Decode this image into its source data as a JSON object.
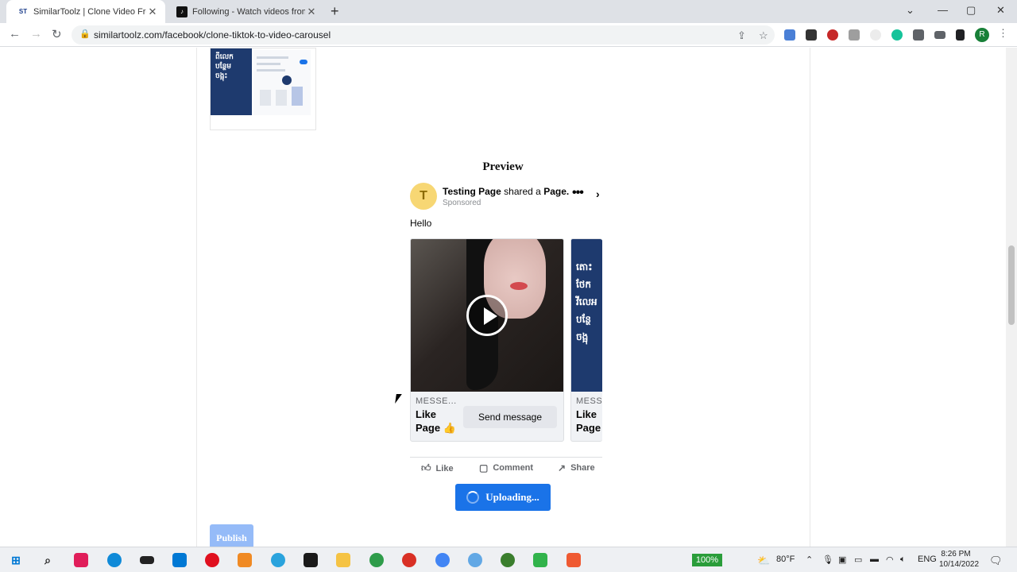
{
  "browser": {
    "tabs": [
      {
        "title": "SimilarToolz | Clone Video From ",
        "favicon": "ST",
        "active": true
      },
      {
        "title": "Following - Watch videos from c",
        "favicon": "tiktok",
        "active": false
      }
    ],
    "url": "similartoolz.com/facebook/clone-tiktok-to-video-carousel",
    "profile_initial": "R"
  },
  "thumbnail": {
    "lines": [
      "ពីលេក",
      "បន្ថែម",
      "ចង្អុះ"
    ]
  },
  "preview": {
    "heading": "Preview",
    "avatar_letter": "T",
    "page_name": "Testing Page",
    "shared_text": "shared a",
    "shared_object": "Page.",
    "sponsored": "Sponsored",
    "message": "Hello",
    "cards": [
      {
        "label": "MESSE...",
        "title": "Like Page 👍",
        "button": "Send message"
      },
      {
        "label": "MESSE",
        "title": "Like Page",
        "image_text": "តោះ\nថែក\nវីលេអ\nបន្ថែ\nចង្អុ"
      }
    ],
    "actions": {
      "like": "Like",
      "comment": "Comment",
      "share": "Share"
    }
  },
  "buttons": {
    "uploading": "Uploading...",
    "publish": "Publish"
  },
  "taskbar": {
    "zoom": "100%",
    "weather": "80°F",
    "lang": "ENG",
    "time": "8:26 PM",
    "date": "10/14/2022"
  },
  "colors": {
    "accent": "#1a73e8",
    "navy": "#1e3a6e",
    "avatar": "#f7d774"
  }
}
